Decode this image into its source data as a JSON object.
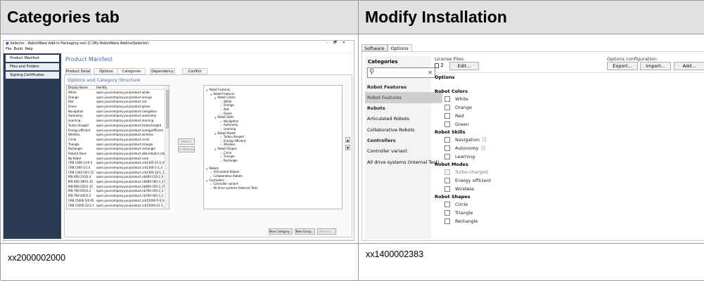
{
  "headers": {
    "left": "Categories tab",
    "right": "Modify Installation"
  },
  "captions": {
    "left": "xx2000002000",
    "right": "xx1400002383"
  },
  "left_window": {
    "title": "Selector - RobotWare Add-in Packaging tool (C:\\My RobotWare Addins\\Selector)",
    "menu": [
      "File",
      "Build",
      "Help"
    ],
    "controls": [
      "–",
      "🗗",
      "✕"
    ],
    "nav": [
      "Product Manifest",
      "Files and Folders",
      "Signing Certificates"
    ],
    "page_title": "Product Manifest",
    "tabs": [
      "Product Details",
      "Options",
      "Categories",
      "Dependency",
      "Conflict"
    ],
    "section_title": "Options and Category Structure",
    "table_headers": [
      "Display Name",
      "Identity"
    ],
    "table_rows": [
      [
        "White",
        "open.yourcompany.yourproduct.white"
      ],
      [
        "Orange",
        "open.yourcompany.yourproduct.orange"
      ],
      [
        "Red",
        "open.yourcompany.yourproduct.red"
      ],
      [
        "Green",
        "open.yourcompany.yourproduct.green"
      ],
      [
        "Navigation",
        "open.yourcompany.yourproduct.navigation"
      ],
      [
        "Autonomy",
        "open.yourcompany.yourproduct.autonomy"
      ],
      [
        "Learning",
        "open.yourcompany.yourproduct.learning"
      ],
      [
        "Turbo-charged",
        "open.yourcompany.yourproduct.turbocharged"
      ],
      [
        "Energy efficient",
        "open.yourcompany.yourproduct.energyefficient"
      ],
      [
        "Wireless",
        "open.yourcompany.yourproduct.wireless"
      ],
      [
        "Circle",
        "open.yourcompany.yourproduct.circle"
      ],
      [
        "Triangle",
        "open.yourcompany.yourproduct.triangle"
      ],
      [
        "Rectangle",
        "open.yourcompany.yourproduct.rectangle"
      ],
      [
        "Robotic Base",
        "open.yourcompany.yourproduct.abb.robotics.robotcb"
      ],
      [
        "No Robot",
        "open.yourcompany.yourproduct.norb"
      ],
      [
        "CRB 1300-11/0.9",
        "open.yourcompany.yourproduct.crb1300-11-0_9"
      ],
      [
        "CRB 1300-1/1.4",
        "open.yourcompany.yourproduct.crb1300-1-1_4"
      ],
      [
        "CRB 1300-10/1.15",
        "open.yourcompany.yourproduct.crb1300-10-1_15"
      ],
      [
        "IRB 460-110/2.4",
        "open.yourcompany.yourproduct.irb460-110-2_4"
      ],
      [
        "IRB 660-180/3.15",
        "open.yourcompany.yourproduct.irb660-180-3_15"
      ],
      [
        "IRB 660-250/3.15",
        "open.yourcompany.yourproduct.irb660-250-3_15"
      ],
      [
        "IRB 760-450/3.2",
        "open.yourcompany.yourproduct.irb760-450-3_2"
      ],
      [
        "IRB 760-445/3.2",
        "open.yourcompany.yourproduct.irb760-445-3_2"
      ],
      [
        "CRB 15000-5/0.95",
        "open.yourcompany.yourproduct.crb15000-5-0_95"
      ],
      [
        "CRB 15000-12/1.3",
        "open.yourcompany.yourproduct.crb15000-12-1_3"
      ]
    ],
    "add_button": "Add>>",
    "remove_button": "<<Remove",
    "tree": [
      {
        "t": "Robot Features",
        "l": 0,
        "a": "▲"
      },
      {
        "t": "Robot Features",
        "l": 1,
        "a": "▲"
      },
      {
        "t": "Robot Colors",
        "l": 2,
        "a": "▲"
      },
      {
        "t": "White",
        "l": 3,
        "a": "□"
      },
      {
        "t": "Orange",
        "l": 3,
        "a": "□"
      },
      {
        "t": "Red",
        "l": 3,
        "a": "□"
      },
      {
        "t": "Green",
        "l": 3,
        "a": "□"
      },
      {
        "t": "Robot Skills",
        "l": 2,
        "a": "▲"
      },
      {
        "t": "Navigation",
        "l": 3,
        "a": "□"
      },
      {
        "t": "Autonomy",
        "l": 3,
        "a": "□"
      },
      {
        "t": "Learning",
        "l": 3,
        "a": "□"
      },
      {
        "t": "Robot Modes",
        "l": 2,
        "a": "▲"
      },
      {
        "t": "Turbo-charged",
        "l": 3,
        "a": "□"
      },
      {
        "t": "Energy efficient",
        "l": 3,
        "a": "□"
      },
      {
        "t": "Wireless",
        "l": 3,
        "a": "□"
      },
      {
        "t": "Robot Shapes",
        "l": 2,
        "a": "▲"
      },
      {
        "t": "Circle",
        "l": 3,
        "a": "□"
      },
      {
        "t": "Triangle",
        "l": 3,
        "a": "□"
      },
      {
        "t": "Rectangle",
        "l": 3,
        "a": "□"
      },
      {
        "t": "",
        "l": 0,
        "a": ""
      },
      {
        "t": "Robots",
        "l": 0,
        "a": "▲"
      },
      {
        "t": "Articulated Robots",
        "l": 1,
        "a": "▷"
      },
      {
        "t": "Collaborative Robots",
        "l": 1,
        "a": "▷"
      },
      {
        "t": "Controllers",
        "l": 0,
        "a": "▲"
      },
      {
        "t": "Controller variant",
        "l": 1,
        "a": "▷"
      },
      {
        "t": "All drive systems (Internal Test)",
        "l": 1,
        "a": "▷"
      }
    ],
    "up_icon": "▲",
    "down_icon": "▼",
    "bottom_buttons": [
      "New Category...",
      "New Group...",
      "Rename..."
    ]
  },
  "right_window": {
    "tabs": [
      "Software",
      "Options"
    ],
    "categories_label": "Categories",
    "search_placeholder": "",
    "clear_icon": "✕",
    "categories": [
      {
        "t": "Robot Features",
        "type": "header"
      },
      {
        "t": "Robot Features",
        "type": "selected"
      },
      {
        "t": "Robots",
        "type": "header"
      },
      {
        "t": "Articulated Robots",
        "type": "item"
      },
      {
        "t": "Collaborative Robots",
        "type": "item"
      },
      {
        "t": "Controllers",
        "type": "header"
      },
      {
        "t": "Controller variant",
        "type": "item"
      },
      {
        "t": "All drive systems (Internal Test)",
        "type": "item"
      }
    ],
    "license_label": "License Files:",
    "license_count": "2",
    "edit_button": "Edit...",
    "options_config_label": "Options configuration:",
    "export_button": "Export...",
    "import_button": "Import...",
    "add_button": "Add...",
    "options_heading": "Options",
    "groups": [
      {
        "title": "Robot Colors",
        "items": [
          {
            "t": "White",
            "dis": false,
            "link": false
          },
          {
            "t": "Orange",
            "dis": false,
            "link": false
          },
          {
            "t": "Red",
            "dis": false,
            "link": false
          },
          {
            "t": "Green",
            "dis": false,
            "link": false
          }
        ]
      },
      {
        "title": "Robot Skills",
        "items": [
          {
            "t": "Navigation",
            "dis": false,
            "link": true
          },
          {
            "t": "Autonomy",
            "dis": false,
            "link": true
          },
          {
            "t": "Learning",
            "dis": false,
            "link": false
          }
        ]
      },
      {
        "title": "Robot Modes",
        "items": [
          {
            "t": "Turbo-charged",
            "dis": true,
            "link": false
          },
          {
            "t": "Energy efficient",
            "dis": false,
            "link": false
          },
          {
            "t": "Wireless",
            "dis": false,
            "link": false
          }
        ]
      },
      {
        "title": "Robot Shapes",
        "items": [
          {
            "t": "Circle",
            "dis": false,
            "link": false
          },
          {
            "t": "Triangle",
            "dis": false,
            "link": false
          },
          {
            "t": "Rectangle",
            "dis": false,
            "link": false
          }
        ]
      }
    ]
  },
  "colors": {
    "nav_bg": "#2b3a55",
    "accent": "#3a6fb4",
    "header_bg": "#e2e2e2",
    "selected_bg": "#cfcfcf",
    "link_icon": "#9ab8de"
  }
}
